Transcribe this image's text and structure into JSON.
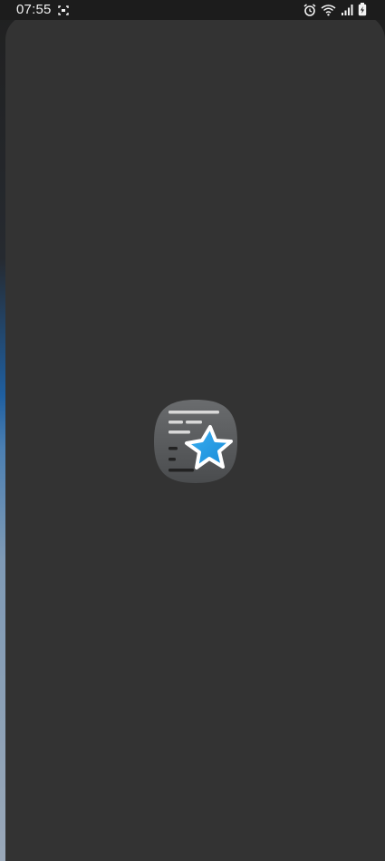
{
  "status_bar": {
    "time": "07:55",
    "icons": [
      "screenshot-icon",
      "alarm-icon",
      "wifi-icon",
      "signal-icon",
      "battery-icon"
    ]
  },
  "splash": {
    "icon": "anki-app-icon",
    "colors": {
      "window": "#333333",
      "icon_tile": "#585a5c",
      "star": "#1e9be6",
      "status_bar": "#1c1c1c"
    }
  }
}
